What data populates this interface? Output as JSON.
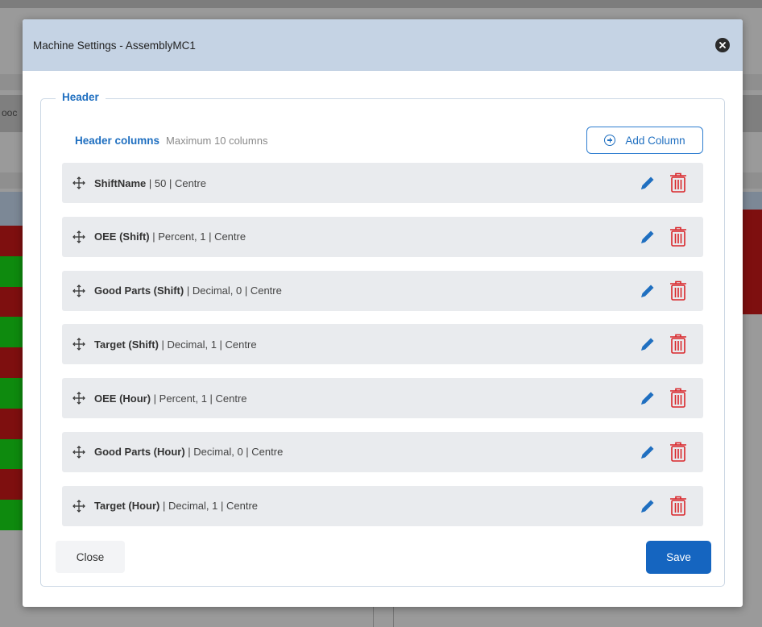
{
  "background": {
    "side_text": "ooc"
  },
  "dialog": {
    "title": "Machine Settings - AssemblyMC1",
    "close_icon": "close-circle-icon",
    "section_legend": "Header",
    "header_columns_title": "Header columns",
    "header_columns_hint": "Maximum 10 columns",
    "add_column_label": "Add Column",
    "columns": [
      {
        "name": "ShiftName",
        "detail": " | 50 | Centre"
      },
      {
        "name": "OEE (Shift)",
        "detail": " | Percent, 1 | Centre"
      },
      {
        "name": "Good Parts (Shift)",
        "detail": " | Decimal, 0 | Centre"
      },
      {
        "name": "Target (Shift)",
        "detail": " | Decimal, 1 | Centre"
      },
      {
        "name": "OEE (Hour)",
        "detail": " | Percent, 1 | Centre"
      },
      {
        "name": "Good Parts (Hour)",
        "detail": " | Decimal, 0 | Centre"
      },
      {
        "name": "Target (Hour)",
        "detail": " | Decimal, 1 | Centre"
      }
    ],
    "close_label": "Close",
    "save_label": "Save"
  },
  "colors": {
    "accent": "#1f6fc0",
    "save": "#1565c0",
    "delete": "#d9262a",
    "header_bg": "#c5d3e4",
    "row_bg": "#e9ebee",
    "bg_red": "#7e0f0f",
    "bg_green": "#0e8a0e"
  }
}
